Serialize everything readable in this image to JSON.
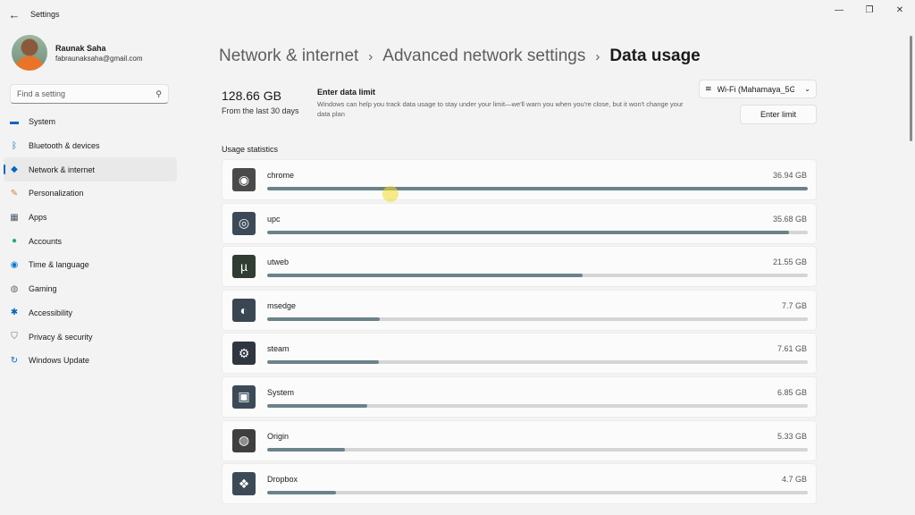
{
  "titlebar": {
    "app_title": "Settings",
    "back_icon": "arrow-left-icon",
    "minimize_icon": "minimize-icon",
    "maximize_icon": "maximize-icon",
    "close_icon": "close-icon"
  },
  "profile": {
    "name": "Raunak Saha",
    "email": "fabraunaksaha@gmail.com"
  },
  "search": {
    "placeholder": "Find a setting"
  },
  "sidebar": {
    "items": [
      {
        "label": "System",
        "icon": "monitor-icon",
        "color": "#0067c0"
      },
      {
        "label": "Bluetooth & devices",
        "icon": "bluetooth-icon",
        "color": "#0067c0"
      },
      {
        "label": "Network & internet",
        "icon": "wifi-icon",
        "color": "#0067c0",
        "active": true
      },
      {
        "label": "Personalization",
        "icon": "brush-icon",
        "color": "#d9822b"
      },
      {
        "label": "Apps",
        "icon": "apps-icon",
        "color": "#4a5a6a"
      },
      {
        "label": "Accounts",
        "icon": "person-icon",
        "color": "#2aa77b"
      },
      {
        "label": "Time & language",
        "icon": "globe-clock-icon",
        "color": "#0078d4"
      },
      {
        "label": "Gaming",
        "icon": "gamepad-icon",
        "color": "#6a6a6a"
      },
      {
        "label": "Accessibility",
        "icon": "accessibility-icon",
        "color": "#0067c0"
      },
      {
        "label": "Privacy & security",
        "icon": "shield-icon",
        "color": "#6a6a6a"
      },
      {
        "label": "Windows Update",
        "icon": "update-icon",
        "color": "#0067c0"
      }
    ]
  },
  "breadcrumb": {
    "items": [
      "Network & internet",
      "Advanced network settings"
    ],
    "current": "Data usage"
  },
  "summary": {
    "total": "128.66 GB",
    "period": "From the last 30 days"
  },
  "data_limit": {
    "title": "Enter data limit",
    "description": "Windows can help you track data usage to stay under your limit—we'll warn you when you're close, but it won't change your data plan",
    "button_label": "Enter limit"
  },
  "network_select": {
    "value": "Wi-Fi (Mahamaya_5G",
    "icon": "wifi-icon"
  },
  "usage": {
    "title": "Usage statistics",
    "apps": [
      {
        "name": "chrome",
        "usage": "36.94 GB",
        "fraction": 1.0,
        "icon": "chrome-icon",
        "color": "#4a4a4a"
      },
      {
        "name": "upc",
        "usage": "35.68 GB",
        "fraction": 0.966,
        "icon": "upc-icon",
        "color": "#3c4a58"
      },
      {
        "name": "utweb",
        "usage": "21.55 GB",
        "fraction": 0.583,
        "icon": "utorrent-icon",
        "color": "#2f3d33"
      },
      {
        "name": "msedge",
        "usage": "7.7 GB",
        "fraction": 0.208,
        "icon": "edge-icon",
        "color": "#3a4652"
      },
      {
        "name": "steam",
        "usage": "7.61 GB",
        "fraction": 0.206,
        "icon": "steam-icon",
        "color": "#2f3640"
      },
      {
        "name": "System",
        "usage": "6.85 GB",
        "fraction": 0.185,
        "icon": "system-window-icon",
        "color": "#3c4a58"
      },
      {
        "name": "Origin",
        "usage": "5.33 GB",
        "fraction": 0.144,
        "icon": "origin-icon",
        "color": "#3f3f3f"
      },
      {
        "name": "Dropbox",
        "usage": "4.7 GB",
        "fraction": 0.127,
        "icon": "dropbox-icon",
        "color": "#3c4a58"
      }
    ]
  }
}
